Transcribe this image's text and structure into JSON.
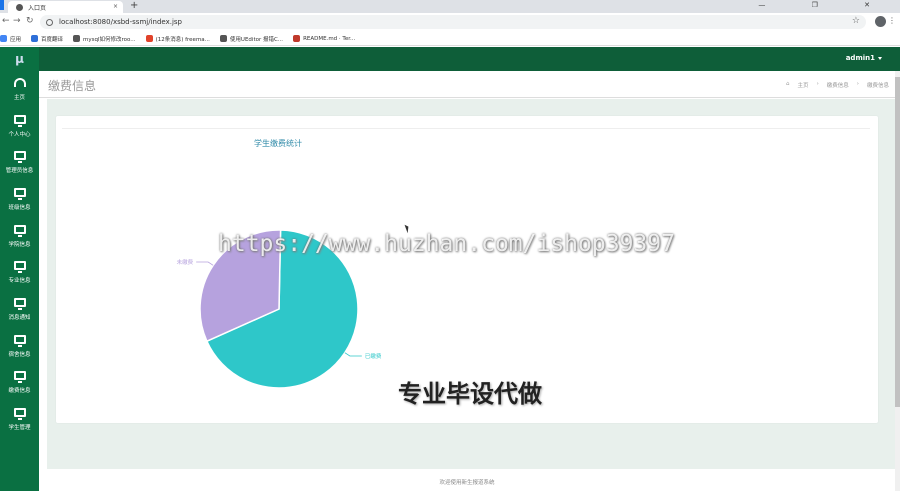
{
  "browser": {
    "tab_title": "入口页",
    "tab_close": "×",
    "new_tab": "+",
    "window_controls": "—  ❐  ✕",
    "url": "localhost:8080/xsbd-ssmj/index.jsp",
    "bookmarks": [
      {
        "label": "应用",
        "color": "#4285f4"
      },
      {
        "label": "百度翻译",
        "color": "#2e6fd8"
      },
      {
        "label": "mysql如何修改roo...",
        "color": "#555"
      },
      {
        "label": "(12条消息) freema...",
        "color": "#e1432b"
      },
      {
        "label": "使用UEditor 报错C...",
        "color": "#555"
      },
      {
        "label": "README.md · Ter...",
        "color": "#c0392b"
      }
    ]
  },
  "app": {
    "logo": "μ",
    "user": "admin1",
    "page_title": "缴费信息",
    "breadcrumb": [
      "主页",
      "›",
      "缴费信息",
      "›",
      "缴费信息"
    ],
    "sidebar": [
      {
        "label": "主页",
        "icon": "dashboard-icon"
      },
      {
        "label": "个人中心",
        "icon": "monitor-icon"
      },
      {
        "label": "管理员信息",
        "icon": "monitor-icon"
      },
      {
        "label": "班级信息",
        "icon": "monitor-icon"
      },
      {
        "label": "学院信息",
        "icon": "monitor-icon"
      },
      {
        "label": "专业信息",
        "icon": "monitor-icon"
      },
      {
        "label": "消息通知",
        "icon": "monitor-icon"
      },
      {
        "label": "宿舍信息",
        "icon": "monitor-icon"
      },
      {
        "label": "缴费信息",
        "icon": "monitor-icon"
      },
      {
        "label": "学生管理",
        "icon": "monitor-icon"
      }
    ],
    "footer": "欢迎使用新生报道系统",
    "colors": {
      "sidebar": "#0a7042",
      "topnav": "#0e5e39",
      "content_bg": "#e8f0ec"
    }
  },
  "watermark": {
    "url_text": "https://www.huzhan.com/ishop39397",
    "slogan": "专业毕设代做"
  },
  "chart_data": {
    "type": "pie",
    "title": "学生缴费统计",
    "slices": [
      {
        "label": "已缴费",
        "value": 68,
        "color": "#2ec7c9"
      },
      {
        "label": "未缴费",
        "value": 32,
        "color": "#b6a2de"
      }
    ]
  }
}
